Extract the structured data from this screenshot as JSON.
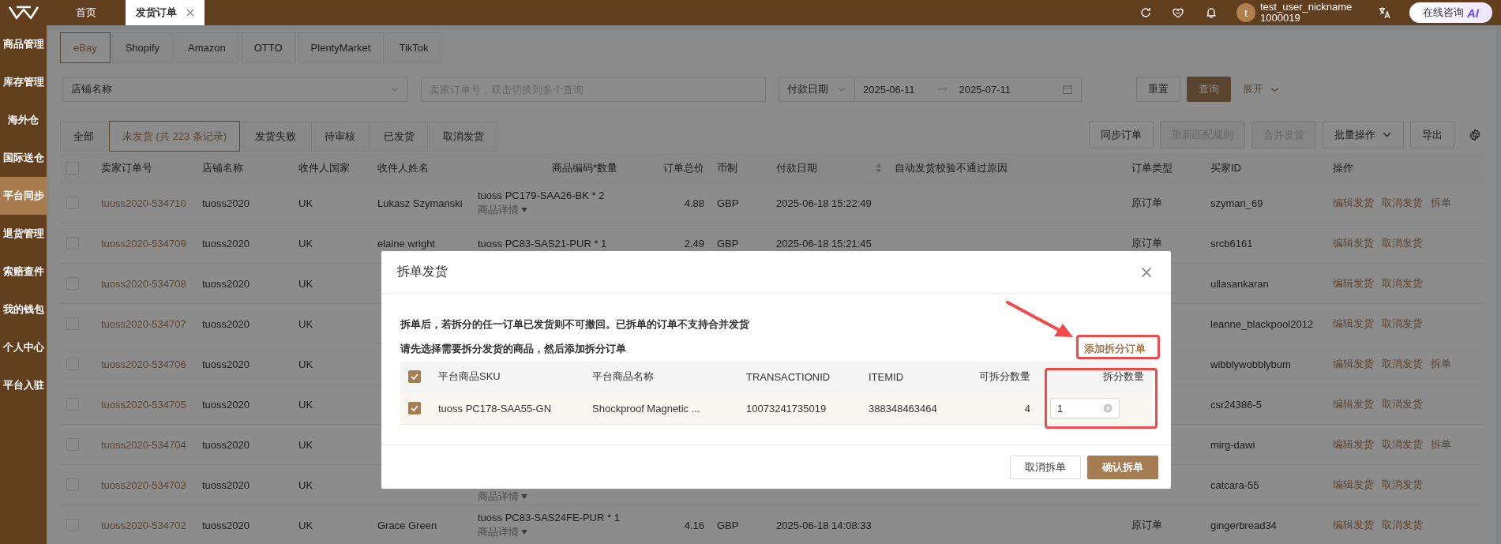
{
  "top_tabs": [
    {
      "label": "首页",
      "selected": false,
      "closable": false
    },
    {
      "label": "发货订单",
      "selected": true,
      "closable": true
    }
  ],
  "header": {
    "avatar_initial": "t",
    "user_name": "test_user_nickname",
    "user_id": "1000019",
    "assistant_label": "在线咨询",
    "assistant_badge": "AI"
  },
  "sidebar": {
    "items": [
      {
        "label": "商品管理",
        "selected": false
      },
      {
        "label": "库存管理",
        "selected": false
      },
      {
        "label": "海外仓",
        "selected": false
      },
      {
        "label": "国际送仓",
        "selected": false
      },
      {
        "label": "平台同步",
        "selected": true
      },
      {
        "label": "退货管理",
        "selected": false
      },
      {
        "label": "索赔查件",
        "selected": false
      },
      {
        "label": "我的钱包",
        "selected": false
      },
      {
        "label": "个人中心",
        "selected": false
      },
      {
        "label": "平台入驻",
        "selected": false
      }
    ]
  },
  "platform_tabs": [
    {
      "label": "eBay",
      "selected": true
    },
    {
      "label": "Shopify",
      "selected": false
    },
    {
      "label": "Amazon",
      "selected": false
    },
    {
      "label": "OTTO",
      "selected": false
    },
    {
      "label": "PlentyMarket",
      "selected": false
    },
    {
      "label": "TikTok",
      "selected": false
    }
  ],
  "filters": {
    "store": {
      "placeholder": "店铺名称"
    },
    "order_search": {
      "placeholder": "卖家订单号，双击切换到多个查询"
    },
    "date_type": {
      "value": "付款日期"
    },
    "date_start": "2025-06-11",
    "date_end": "2025-07-11",
    "reset_button": "重置",
    "query_button": "查询",
    "expand_toggle": "展开"
  },
  "status_tabs": [
    {
      "label": "全部",
      "selected": false
    },
    {
      "label": "未发货 (共 223 条记录)",
      "selected": true
    },
    {
      "label": "发货失败",
      "selected": false
    },
    {
      "label": "待审核",
      "selected": false
    },
    {
      "label": "已发货",
      "selected": false
    },
    {
      "label": "取消发货",
      "selected": false
    }
  ],
  "toolbar_buttons": [
    {
      "label": "同步订单",
      "disabled": false,
      "dropdown": false
    },
    {
      "label": "重新匹配规则",
      "disabled": true,
      "dropdown": false
    },
    {
      "label": "合并发货",
      "disabled": true,
      "dropdown": false
    },
    {
      "label": "批量操作",
      "disabled": false,
      "dropdown": true
    },
    {
      "label": "导出",
      "disabled": false,
      "dropdown": false
    }
  ],
  "table": {
    "select_all_checked": false,
    "columns": [
      {
        "label": "卖家订单号",
        "sortable": false
      },
      {
        "label": "店铺名称",
        "sortable": false
      },
      {
        "label": "收件人国家",
        "sortable": false
      },
      {
        "label": "收件人姓名",
        "sortable": false
      },
      {
        "label": "商品编码*数量",
        "sortable": false
      },
      {
        "label": "订单总价",
        "sortable": false
      },
      {
        "label": "币制",
        "sortable": false
      },
      {
        "label": "付款日期",
        "sortable": true
      },
      {
        "label": "自动发货校验不通过原因",
        "sortable": false
      },
      {
        "label": "订单类型",
        "sortable": false
      },
      {
        "label": "买家ID",
        "sortable": false
      },
      {
        "label": "操作",
        "sortable": false
      }
    ],
    "rows": [
      {
        "checked": false,
        "order_no": "tuoss2020-534710",
        "shop": "tuoss2020",
        "country": "UK",
        "recipient": "Lukasz Szymanski",
        "product": "tuoss PC179-SAA26-BK * 2",
        "product_detail": "商品详情",
        "price": "4.88",
        "currency": "GBP",
        "paid_at": "2025-06-18 15:22:49",
        "order_type": "原订单",
        "buyer_id": "szyman_69",
        "actions": [
          "编辑发货",
          "取消发货",
          "拆单"
        ]
      },
      {
        "checked": false,
        "order_no": "tuoss2020-534709",
        "shop": "tuoss2020",
        "country": "UK",
        "recipient": "elaine wright",
        "product": "tuoss PC83-SAS21-PUR * 1",
        "price": "2.49",
        "currency": "GBP",
        "paid_at": "2025-06-18 15:21:45",
        "order_type": "原订单",
        "buyer_id": "srcb6161",
        "actions": [
          "编辑发货",
          "取消发货"
        ]
      },
      {
        "checked": false,
        "order_no": "tuoss2020-534708",
        "shop": "tuoss2020",
        "country": "UK",
        "buyer_id": "ullasankaran",
        "actions": [
          "编辑发货",
          "取消发货"
        ]
      },
      {
        "checked": false,
        "order_no": "tuoss2020-534707",
        "shop": "tuoss2020",
        "country": "UK",
        "buyer_id": "leanne_blackpool2012",
        "actions": [
          "编辑发货",
          "取消发货"
        ]
      },
      {
        "checked": false,
        "order_no": "tuoss2020-534706",
        "shop": "tuoss2020",
        "country": "UK",
        "buyer_id": "wibblywobblybum",
        "actions": [
          "编辑发货",
          "取消发货",
          "拆单"
        ]
      },
      {
        "checked": false,
        "order_no": "tuoss2020-534705",
        "shop": "tuoss2020",
        "country": "UK",
        "buyer_id": "csr24386-5",
        "actions": [
          "编辑发货",
          "取消发货"
        ]
      },
      {
        "checked": false,
        "order_no": "tuoss2020-534704",
        "shop": "tuoss2020",
        "country": "UK",
        "buyer_id": "mirg-dawi",
        "actions": [
          "编辑发货",
          "取消发货",
          "拆单"
        ]
      },
      {
        "checked": false,
        "order_no": "tuoss2020-534703",
        "shop": "tuoss2020",
        "country": "UK",
        "product_detail": "商品详情",
        "buyer_id": "catcara-55",
        "actions": [
          "编辑发货",
          "取消发货"
        ]
      },
      {
        "checked": false,
        "order_no": "tuoss2020-534702",
        "shop": "tuoss2020",
        "country": "UK",
        "recipient": "Grace Green",
        "product": "tuoss PC83-SAS24FE-PUR * 1",
        "product_detail": "商品详情",
        "price": "4.16",
        "currency": "GBP",
        "paid_at": "2025-06-18 14:08:33",
        "order_type": "原订单",
        "buyer_id": "gingerbread34",
        "actions": [
          "编辑发货",
          "取消发货"
        ]
      }
    ]
  },
  "modal": {
    "title": "拆单发货",
    "notices": [
      "拆单后，若拆分的任一订单已发货则不可撤回。已拆单的订单不支持合并发货",
      "请先选择需要拆分发货的商品，然后添加拆分订单"
    ],
    "add_button": "添加拆分订单",
    "table": {
      "select_all_checked": true,
      "columns": [
        "平台商品SKU",
        "平台商品名称",
        "TRANSACTIONID",
        "ITEMID",
        "可拆分数量",
        "拆分数量"
      ],
      "rows": [
        {
          "checked": true,
          "sku": "tuoss PC178-SAA55-GN",
          "name": "Shockproof Magnetic ...",
          "transaction_id": "10073241735019",
          "item_id": "388348463464",
          "available": "4",
          "quantity": "1"
        }
      ]
    },
    "buttons": [
      {
        "label": "取消拆单",
        "kind": "secondary"
      },
      {
        "label": "确认拆单",
        "kind": "primary"
      }
    ]
  }
}
